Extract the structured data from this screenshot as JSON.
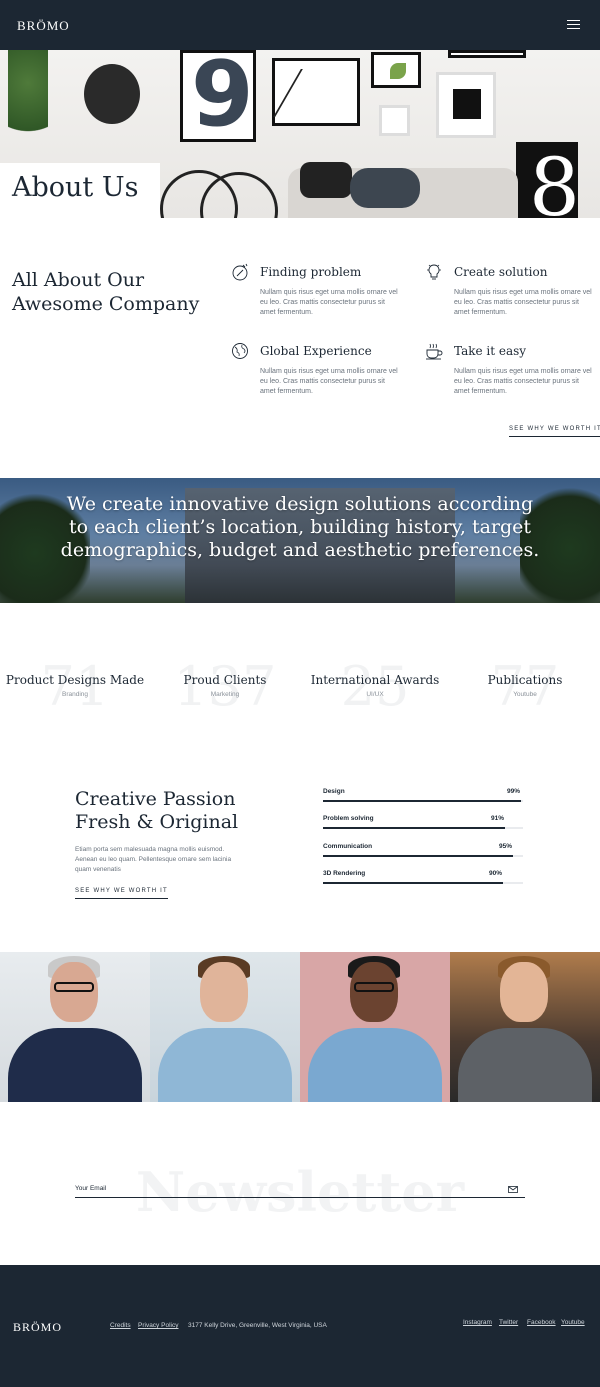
{
  "header": {
    "logo": "BRÖMO",
    "menu_icon": "hamburger-menu-icon"
  },
  "hero": {
    "title": "About Us"
  },
  "about": {
    "title": "All About Our Awesome Company",
    "features": [
      {
        "title": "Finding problem",
        "icon": "compass-icon",
        "text": "Nullam quis risus eget urna mollis ornare vel eu leo. Cras mattis consectetur purus sit amet fermentum."
      },
      {
        "title": "Create solution",
        "icon": "lightbulb-icon",
        "text": "Nullam quis risus eget urna mollis ornare vel eu leo. Cras mattis consectetur purus sit amet fermentum."
      },
      {
        "title": "Global Experience",
        "icon": "globe-icon",
        "text": "Nullam quis risus eget urna mollis ornare vel eu leo. Cras mattis consectetur purus sit amet fermentum."
      },
      {
        "title": "Take it easy",
        "icon": "coffee-cup-icon",
        "text": "Nullam quis risus eget urna mollis ornare vel eu leo. Cras mattis consectetur purus sit amet fermentum."
      }
    ],
    "link": "SEE WHY WE WORTH IT"
  },
  "banner": {
    "text": "We create innovative design solutions according to each client’s location, building history, target demographics, budget and aesthetic preferences."
  },
  "stats": [
    {
      "number": "71",
      "label": "Product Designs Made",
      "sub": "Branding"
    },
    {
      "number": "137",
      "label": "Proud Clients",
      "sub": "Marketing"
    },
    {
      "number": "25",
      "label": "International Awards",
      "sub": "UI/UX"
    },
    {
      "number": "77",
      "label": "Publications",
      "sub": "Youtube"
    }
  ],
  "passion": {
    "title": "Creative Passion Fresh & Original",
    "text": "Etiam porta sem malesuada magna mollis euismod. Aenean eu leo quam. Pellentesque ornare sem lacinia quam venenatis",
    "link": "SEE WHY WE WORTH IT",
    "skills": [
      {
        "name": "Design",
        "percent_label": "99%",
        "value": 0.99
      },
      {
        "name": "Problem solving",
        "percent_label": "91%",
        "value": 0.91
      },
      {
        "name": "Communication",
        "percent_label": "95%",
        "value": 0.95
      },
      {
        "name": "3D Rendering",
        "percent_label": "90%",
        "value": 0.9
      }
    ]
  },
  "newsletter": {
    "watermark": "Newsletter",
    "label": "Your Email",
    "send_icon": "envelope-icon"
  },
  "footer": {
    "logo": "BRÖMO",
    "links": [
      "Credits",
      "Privacy Policy"
    ],
    "address": "3177 Kelly Drive, Greenville, West Virginia, USA",
    "social": [
      "Instagram",
      "Twitter",
      "Facebook",
      "Youtube"
    ]
  },
  "colors": {
    "dark": "#1c2733",
    "muted": "#6a737d"
  }
}
